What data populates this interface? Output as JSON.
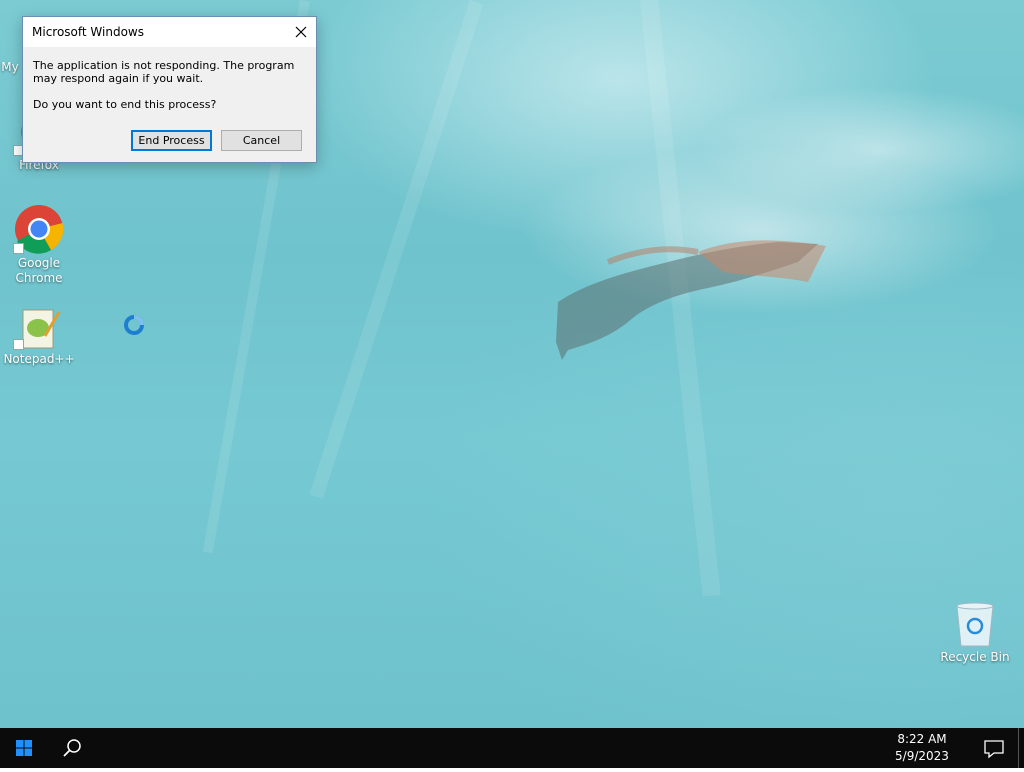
{
  "dialog": {
    "title": "Microsoft Windows",
    "message": "The application is not responding. The program may respond again if you wait.",
    "question": "Do you want to end this process?",
    "end_process_label": "End Process",
    "cancel_label": "Cancel"
  },
  "desktop": {
    "icons": [
      {
        "label": "My",
        "icon": "my-computer-icon"
      },
      {
        "label": "Firefox",
        "icon": "firefox-icon"
      },
      {
        "label": "Google Chrome",
        "icon": "chrome-icon"
      },
      {
        "label": "Notepad++",
        "icon": "notepad-plus-plus-icon"
      },
      {
        "label": "Recycle Bin",
        "icon": "recycle-bin-icon"
      }
    ],
    "busy_cursor": "loading-spinner-icon"
  },
  "taskbar": {
    "time": "8:22 AM",
    "date": "5/9/2023",
    "start_icon": "windows-start-icon",
    "search_icon": "search-icon",
    "notification_icon": "action-center-icon"
  },
  "colors": {
    "accent": "#0078d7",
    "taskbar": "#0b0b0b",
    "dialog_bg": "#f0f0f0"
  }
}
